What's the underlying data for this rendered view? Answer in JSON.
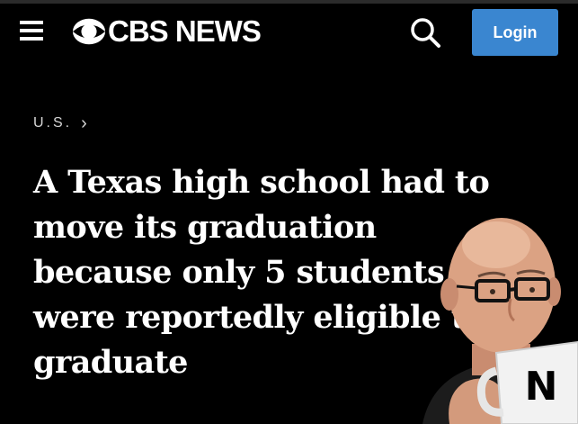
{
  "header": {
    "logo_text": "CBS NEWS",
    "login_label": "Login",
    "icons": [
      "menu-icon",
      "cbs-eye-icon",
      "search-icon"
    ],
    "accent_color": "#3a86d0",
    "background_color": "#000000"
  },
  "breadcrumb": {
    "section": "U.S.",
    "chevron": "›"
  },
  "article": {
    "headline": "A Texas high school had to move its graduation because only 5 students were reportedly eligible to graduate"
  },
  "overlay": {
    "mug_letter": "N"
  }
}
